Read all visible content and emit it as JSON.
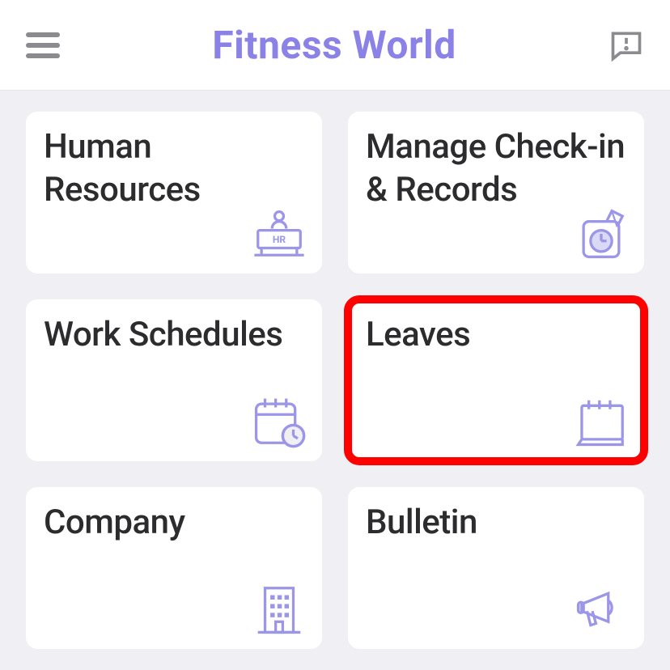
{
  "header": {
    "title": "Fitness World"
  },
  "cards": [
    {
      "label": "Human Resources",
      "icon": "hr-desk-icon",
      "highlighted": false
    },
    {
      "label": "Manage Check-in & Records",
      "icon": "timecard-icon",
      "highlighted": false
    },
    {
      "label": "Work Schedules",
      "icon": "calendar-clock-icon",
      "highlighted": false
    },
    {
      "label": "Leaves",
      "icon": "calendar-leave-icon",
      "highlighted": true
    },
    {
      "label": "Company",
      "icon": "building-icon",
      "highlighted": false
    },
    {
      "label": "Bulletin",
      "icon": "megaphone-icon",
      "highlighted": false
    }
  ]
}
